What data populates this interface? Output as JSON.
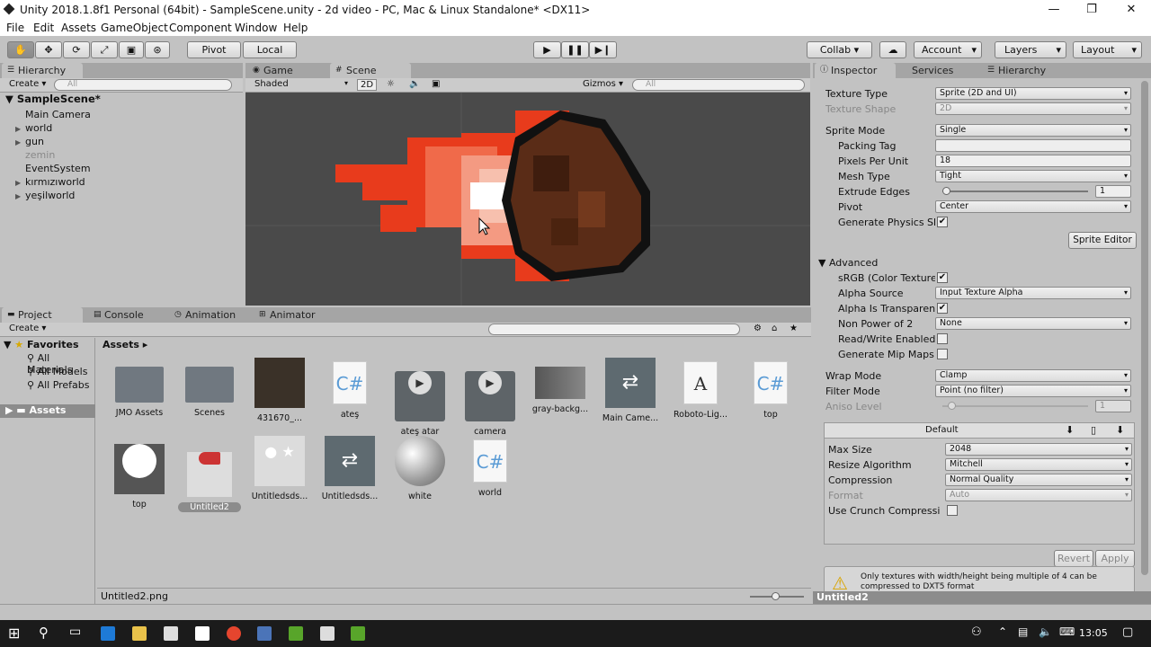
{
  "window": {
    "title": "Unity 2018.1.8f1 Personal (64bit) - SampleScene.unity - 2d video - PC, Mac & Linux Standalone* <DX11>",
    "minimize": "—",
    "maximize": "❐",
    "close": "✕"
  },
  "menu": [
    "File",
    "Edit",
    "Assets",
    "GameObject",
    "Component",
    "Window",
    "Help"
  ],
  "toolbar": {
    "pivot": "Pivot",
    "local": "Local",
    "collab": "Collab ▾",
    "account": "Account",
    "layers": "Layers",
    "layout": "Layout"
  },
  "hierarchy": {
    "tab": "Hierarchy",
    "create": "Create ▾",
    "search_placeholder": "All",
    "scene": "SampleScene*",
    "items": [
      {
        "label": "Main Camera",
        "expandable": false,
        "dim": false
      },
      {
        "label": "world",
        "expandable": true,
        "dim": false
      },
      {
        "label": "gun",
        "expandable": true,
        "dim": false
      },
      {
        "label": "zemin",
        "expandable": false,
        "dim": true
      },
      {
        "label": "EventSystem",
        "expandable": false,
        "dim": false
      },
      {
        "label": "kırmızıworld",
        "expandable": true,
        "dim": false
      },
      {
        "label": "yeşilworld",
        "expandable": true,
        "dim": false
      }
    ]
  },
  "scene": {
    "tab_game": "Game",
    "tab_scene": "Scene",
    "shading": "Shaded",
    "mode2d": "2D",
    "gizmos": "Gizmos ▾",
    "search_placeholder": "All"
  },
  "project": {
    "tabs": [
      "Project",
      "Console",
      "Animation",
      "Animator"
    ],
    "create": "Create ▾",
    "favorites": "Favorites",
    "fav_items": [
      "All Materials",
      "All Models",
      "All Prefabs"
    ],
    "assets_root": "Assets",
    "breadcrumb": "Assets",
    "assets_row1": [
      "JMO Assets",
      "Scenes",
      "431670_...",
      "ateş",
      "ateş atar",
      "camera",
      "gray-backg...",
      "Main Came...",
      "Roboto-Lig...",
      "top"
    ],
    "assets_row2": [
      "top",
      "Untitled2",
      "Untitledsds...",
      "Untitledsds...",
      "white",
      "world"
    ],
    "status_file": "Untitled2.png"
  },
  "inspector": {
    "tabs": [
      "Inspector",
      "Services",
      "Hierarchy"
    ],
    "texture_type": {
      "k": "Texture Type",
      "v": "Sprite (2D and UI)"
    },
    "texture_shape": {
      "k": "Texture Shape",
      "v": "2D"
    },
    "sprite_mode": {
      "k": "Sprite Mode",
      "v": "Single"
    },
    "packing_tag": {
      "k": "Packing Tag",
      "v": ""
    },
    "ppu": {
      "k": "Pixels Per Unit",
      "v": "18"
    },
    "mesh_type": {
      "k": "Mesh Type",
      "v": "Tight"
    },
    "extrude": {
      "k": "Extrude Edges",
      "v": "1"
    },
    "pivot": {
      "k": "Pivot",
      "v": "Center"
    },
    "gen_physics": {
      "k": "Generate Physics Sh"
    },
    "sprite_editor": "Sprite Editor",
    "advanced": "Advanced",
    "srgb": {
      "k": "sRGB (Color Texture"
    },
    "alpha_source": {
      "k": "Alpha Source",
      "v": "Input Texture Alpha"
    },
    "alpha_transp": {
      "k": "Alpha Is Transparen"
    },
    "npot": {
      "k": "Non Power of 2",
      "v": "None"
    },
    "readwrite": {
      "k": "Read/Write Enabled"
    },
    "mipmaps": {
      "k": "Generate Mip Maps"
    },
    "wrap": {
      "k": "Wrap Mode",
      "v": "Clamp"
    },
    "filter": {
      "k": "Filter Mode",
      "v": "Point (no filter)"
    },
    "aniso": {
      "k": "Aniso Level",
      "v": "1"
    },
    "platform_default": "Default",
    "max_size": {
      "k": "Max Size",
      "v": "2048"
    },
    "resize": {
      "k": "Resize Algorithm",
      "v": "Mitchell"
    },
    "compression": {
      "k": "Compression",
      "v": "Normal Quality"
    },
    "format": {
      "k": "Format",
      "v": "Auto"
    },
    "crunch": {
      "k": "Use Crunch Compressi"
    },
    "revert": "Revert",
    "apply": "Apply",
    "warning": "Only textures with width/height being multiple of 4 can be compressed to DXT5 format",
    "footer": "Untitled2"
  },
  "taskbar": {
    "time": "13:05"
  }
}
